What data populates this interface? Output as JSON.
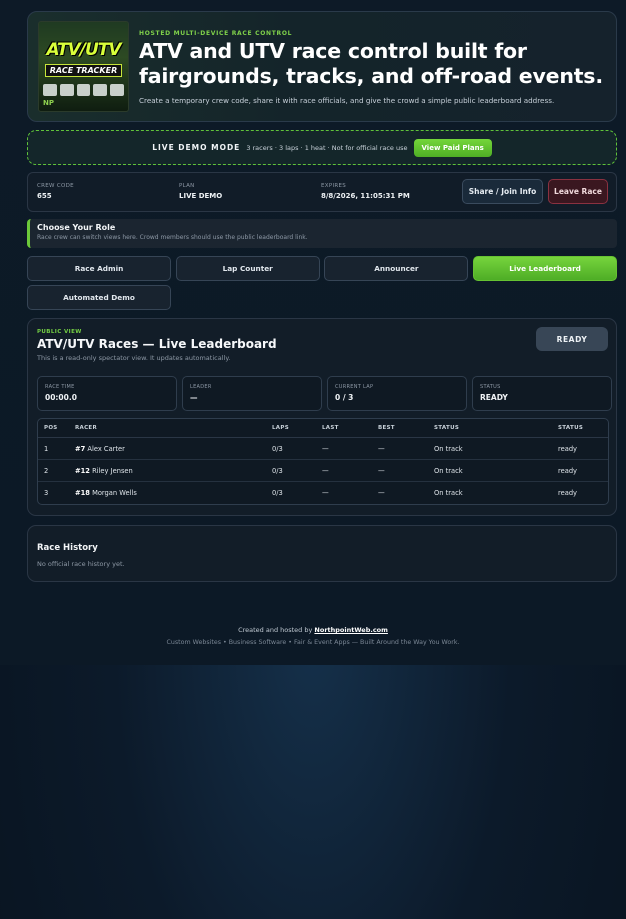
{
  "hero": {
    "logo_line1": "ATV/UTV",
    "logo_line2": "RACE TRACKER",
    "logo_mark": "NP",
    "kicker": "HOSTED MULTI-DEVICE RACE CONTROL",
    "title": "ATV and UTV race control built for fairgrounds, tracks, and off-road events.",
    "subtitle": "Create a temporary crew code, share it with race officials, and give the crowd a simple public leaderboard address."
  },
  "demo": {
    "mode_label": "LIVE DEMO MODE",
    "info": "3 racers · 3 laps · 1 heat · Not for official race use",
    "button": "View Paid Plans"
  },
  "crew": {
    "code_label": "CREW CODE",
    "code_value": "655",
    "plan_label": "PLAN",
    "plan_value": "LIVE DEMO",
    "expires_label": "EXPIRES",
    "expires_value": "8/8/2026, 11:05:31 PM",
    "share_button": "Share / Join Info",
    "leave_button": "Leave Race"
  },
  "role": {
    "title": "Choose Your Role",
    "desc": "Race crew can switch views here. Crowd members should use the public leaderboard link."
  },
  "tabs": [
    "Race Admin",
    "Lap Counter",
    "Announcer",
    "Live Leaderboard",
    "Automated Demo"
  ],
  "board": {
    "view_label": "PUBLIC VIEW",
    "title": "ATV/UTV Races — Live Leaderboard",
    "desc": "This is a read-only spectator view. It updates automatically.",
    "status_badge": "READY",
    "stats": [
      {
        "label": "RACE TIME",
        "value": "00:00.0"
      },
      {
        "label": "LEADER",
        "value": "—"
      },
      {
        "label": "CURRENT LAP",
        "value": "0 / 3"
      },
      {
        "label": "STATUS",
        "value": "READY"
      }
    ],
    "columns": [
      "POS",
      "RACER",
      "LAPS",
      "LAST",
      "BEST",
      "STATUS",
      "STATUS"
    ],
    "rows": [
      {
        "pos": "1",
        "num": "#7",
        "name": "Alex Carter",
        "laps": "0/3",
        "last": "—",
        "best": "—",
        "track": "On track",
        "state": "ready"
      },
      {
        "pos": "2",
        "num": "#12",
        "name": "Riley Jensen",
        "laps": "0/3",
        "last": "—",
        "best": "—",
        "track": "On track",
        "state": "ready"
      },
      {
        "pos": "3",
        "num": "#18",
        "name": "Morgan Wells",
        "laps": "0/3",
        "last": "—",
        "best": "—",
        "track": "On track",
        "state": "ready"
      }
    ]
  },
  "history": {
    "title": "Race History",
    "empty": "No official race history yet."
  },
  "footer": {
    "created": "Created and hosted by",
    "link": "NorthpointWeb.com",
    "tagline": "Custom Websites • Business Software • Fair & Event Apps — Built Around the Way You Work."
  }
}
